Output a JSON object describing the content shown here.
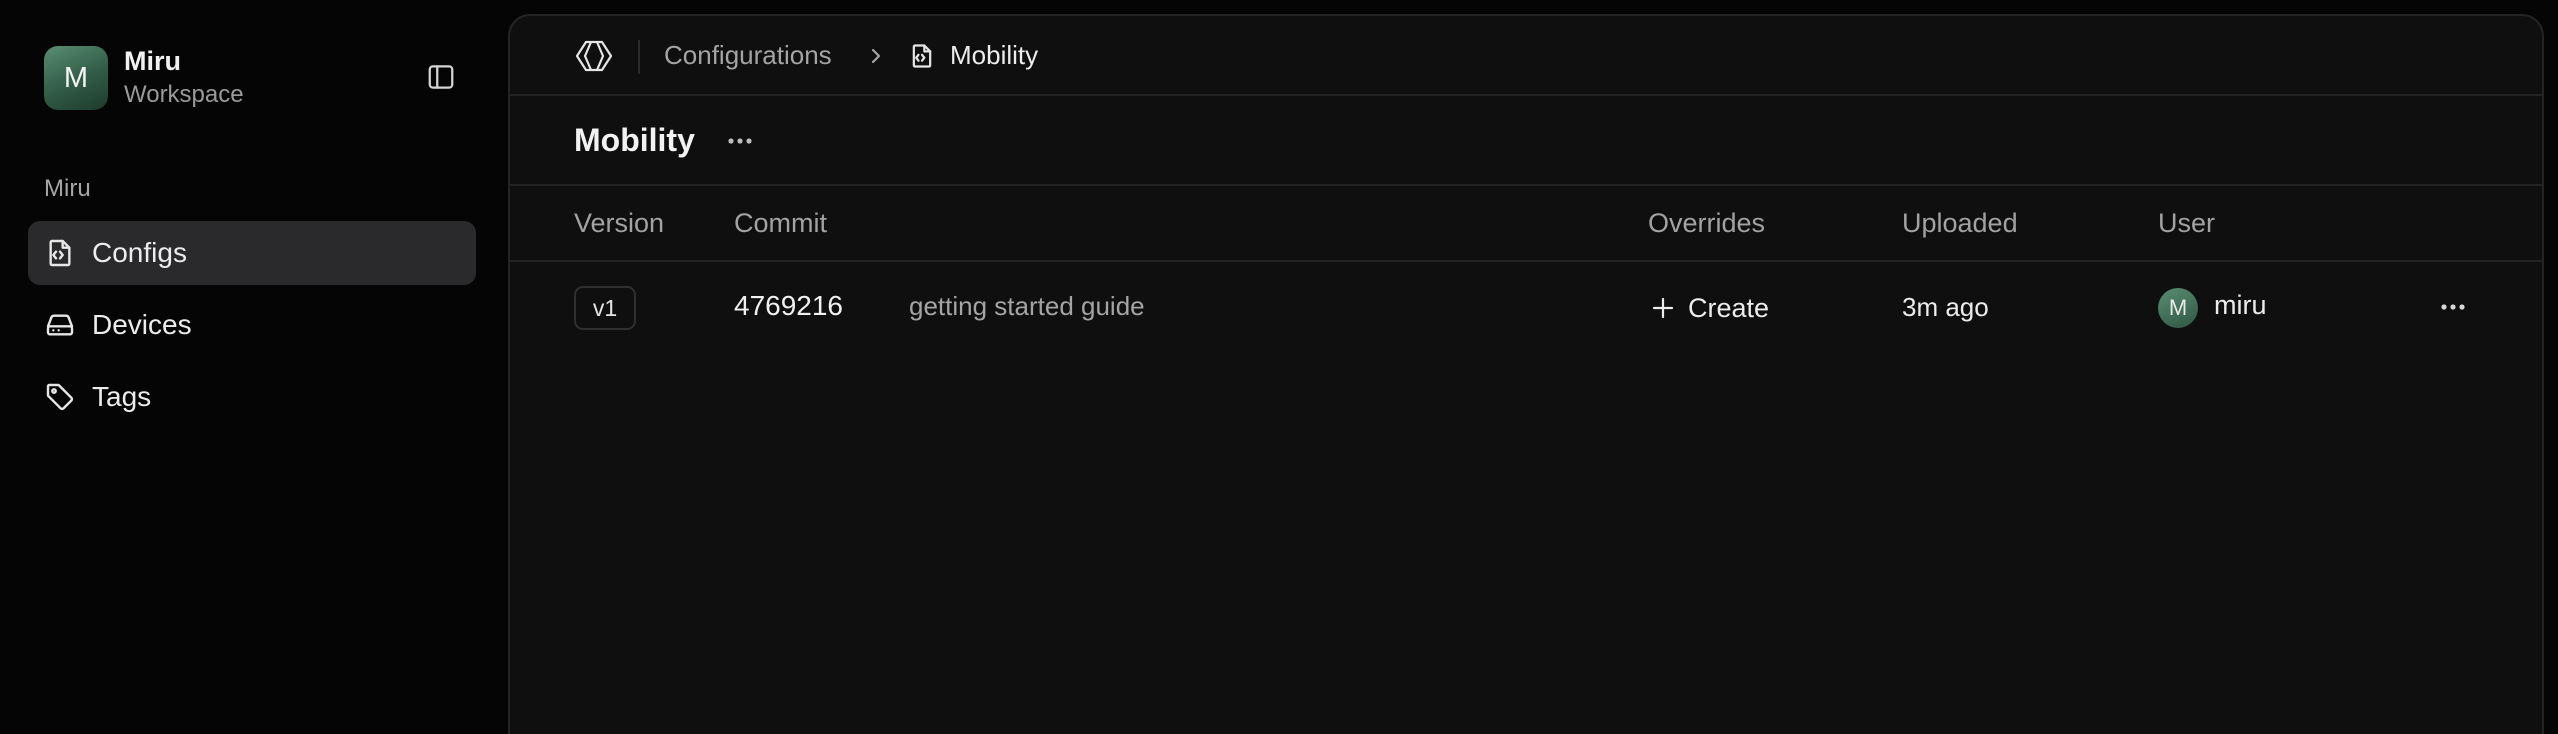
{
  "workspace": {
    "initial": "M",
    "name": "Miru",
    "subtitle": "Workspace"
  },
  "sidebar": {
    "section_label": "Miru",
    "items": [
      {
        "label": "Configs",
        "icon": "file-code-icon",
        "active": true
      },
      {
        "label": "Devices",
        "icon": "hard-drive-icon",
        "active": false
      },
      {
        "label": "Tags",
        "icon": "tag-icon",
        "active": false
      }
    ]
  },
  "breadcrumb": {
    "parent": "Configurations",
    "current": "Mobility"
  },
  "page": {
    "title": "Mobility"
  },
  "table": {
    "headers": [
      "Version",
      "Commit",
      "Overrides",
      "Uploaded",
      "User"
    ],
    "rows": [
      {
        "version": "v1",
        "commit": "4769216",
        "message": "getting started guide",
        "overrides_action": "Create",
        "uploaded": "3m ago",
        "user_initial": "M",
        "user": "miru"
      }
    ]
  },
  "colors": {
    "accent": "#3f6e56",
    "background": "#050505",
    "panel": "#0f0f0f"
  }
}
